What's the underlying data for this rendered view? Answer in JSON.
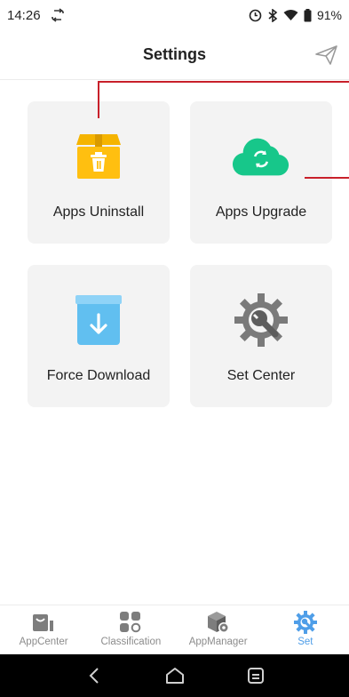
{
  "status_bar": {
    "time": "14:26",
    "battery": "91%",
    "icons": [
      "sync-icon",
      "clock-icon",
      "bluetooth-icon",
      "wifi-icon",
      "battery-icon"
    ]
  },
  "header": {
    "title": "Settings",
    "action_icon": "send-icon"
  },
  "cards": [
    {
      "label": "Apps Uninstall",
      "icon": "box-trash-icon",
      "color": "#f5b400"
    },
    {
      "label": "Apps Upgrade",
      "icon": "cloud-refresh-icon",
      "color": "#17c78a"
    },
    {
      "label": "Force Download",
      "icon": "download-box-icon",
      "color": "#61bff0"
    },
    {
      "label": "Set Center",
      "icon": "gear-wrench-icon",
      "color": "#7a7a7a"
    }
  ],
  "tabs": [
    {
      "label": "AppCenter",
      "icon": "appcenter-icon",
      "active": false
    },
    {
      "label": "Classification",
      "icon": "classification-icon",
      "active": false
    },
    {
      "label": "AppManager",
      "icon": "appmanager-icon",
      "active": false
    },
    {
      "label": "Set",
      "icon": "set-gear-icon",
      "active": true
    }
  ],
  "colors": {
    "accent": "#4f9ee8",
    "annotation": "#c8202a",
    "tab_inactive": "#8c8c8c"
  },
  "navbar": {
    "buttons": [
      "back-icon",
      "home-icon",
      "recents-icon"
    ]
  }
}
